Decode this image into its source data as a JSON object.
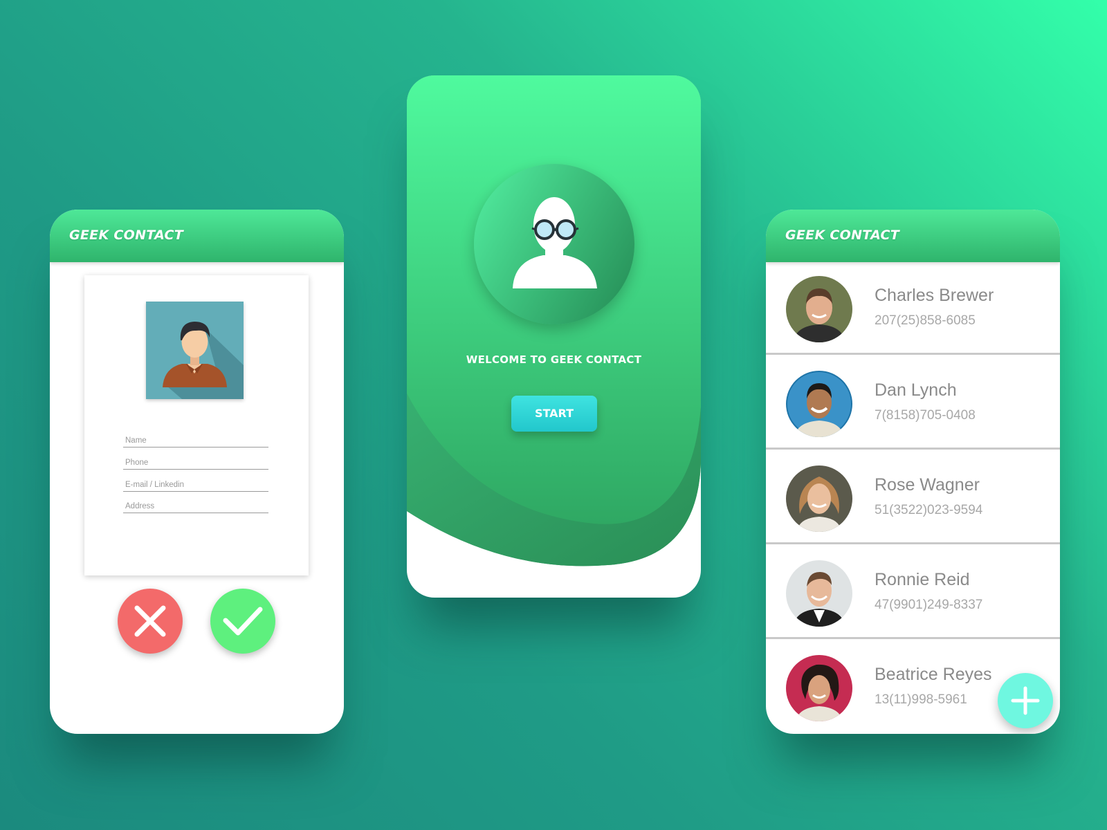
{
  "app": {
    "title": "GEEK CONTACT"
  },
  "colors": {
    "brand_green": "#3fd07f",
    "cancel_red": "#f36a6a",
    "confirm_green": "#5ef07e",
    "start_cyan": "#2fd4d6",
    "fab_cyan": "#6ff7e0"
  },
  "form": {
    "fields": [
      {
        "placeholder": "Name"
      },
      {
        "placeholder": "Phone"
      },
      {
        "placeholder": "E-mail / Linkedin"
      },
      {
        "placeholder": "Address"
      }
    ],
    "cancel_icon": "close-icon",
    "confirm_icon": "check-icon",
    "photo_icon": "user-avatar-icon"
  },
  "welcome": {
    "message": "WELCOME TO GEEK CONTACT",
    "start_label": "START",
    "avatar_icon": "geek-avatar-icon"
  },
  "contacts": [
    {
      "name": "Charles Brewer",
      "phone": "207(25)858-6085"
    },
    {
      "name": "Dan Lynch",
      "phone": "7(8158)705-0408"
    },
    {
      "name": "Rose Wagner",
      "phone": "51(3522)023-9594"
    },
    {
      "name": "Ronnie Reid",
      "phone": "47(9901)249-8337"
    },
    {
      "name": "Beatrice Reyes",
      "phone": "13(11)998-5961"
    }
  ],
  "fab": {
    "icon": "plus-icon"
  }
}
